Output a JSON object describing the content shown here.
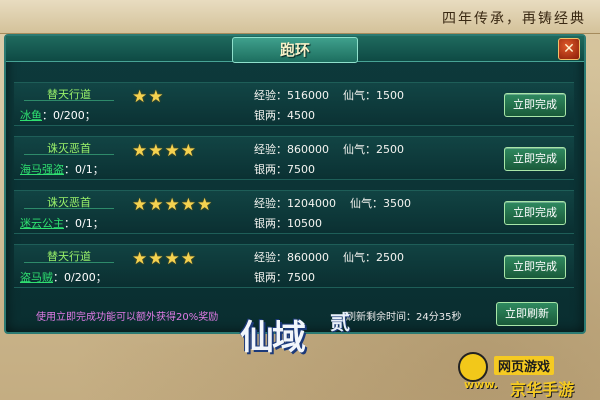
{
  "header": {
    "slogan": "四年传承，再铸经典"
  },
  "panel": {
    "title": "跑环",
    "close_label": "✕"
  },
  "tasks": [
    {
      "title": "替天行道",
      "target_name": "冰鱼",
      "progress": "：0/200；",
      "stars": 2,
      "exp_label": "经验：516000",
      "xianqi_label": "仙气：1500",
      "silver_label": "银两：4500",
      "button_label": "立即完成"
    },
    {
      "title": "诛灭恶首",
      "target_name": "海马强盗",
      "progress": "：0/1；",
      "stars": 4,
      "exp_label": "经验：860000",
      "xianqi_label": "仙气：2500",
      "silver_label": "银两：7500",
      "button_label": "立即完成"
    },
    {
      "title": "诛灭恶首",
      "target_name": "迷云公主",
      "progress": "：0/1；",
      "stars": 5,
      "exp_label": "经验：1204000",
      "xianqi_label": "仙气：3500",
      "silver_label": "银两：10500",
      "button_label": "立即完成"
    },
    {
      "title": "替天行道",
      "target_name": "盗马贼",
      "progress": "：0/200；",
      "stars": 4,
      "exp_label": "经验：860000",
      "xianqi_label": "仙气：2500",
      "silver_label": "银两：7500",
      "button_label": "立即完成"
    }
  ],
  "footer": {
    "tip": "使用立即完成功能可以额外获得20%奖励",
    "timer": "刷新剩余时间：24分35秒",
    "refresh_label": "立即刷新"
  },
  "logo": {
    "main": "仙域",
    "sub": "贰"
  },
  "watermark": {
    "top": "网页游戏",
    "url": "www.",
    "site": "京华手游"
  },
  "colors": {
    "star": "#f5d250",
    "task_title": "#9af26a",
    "target_name": "#2fe070",
    "tip": "#e07be6"
  }
}
